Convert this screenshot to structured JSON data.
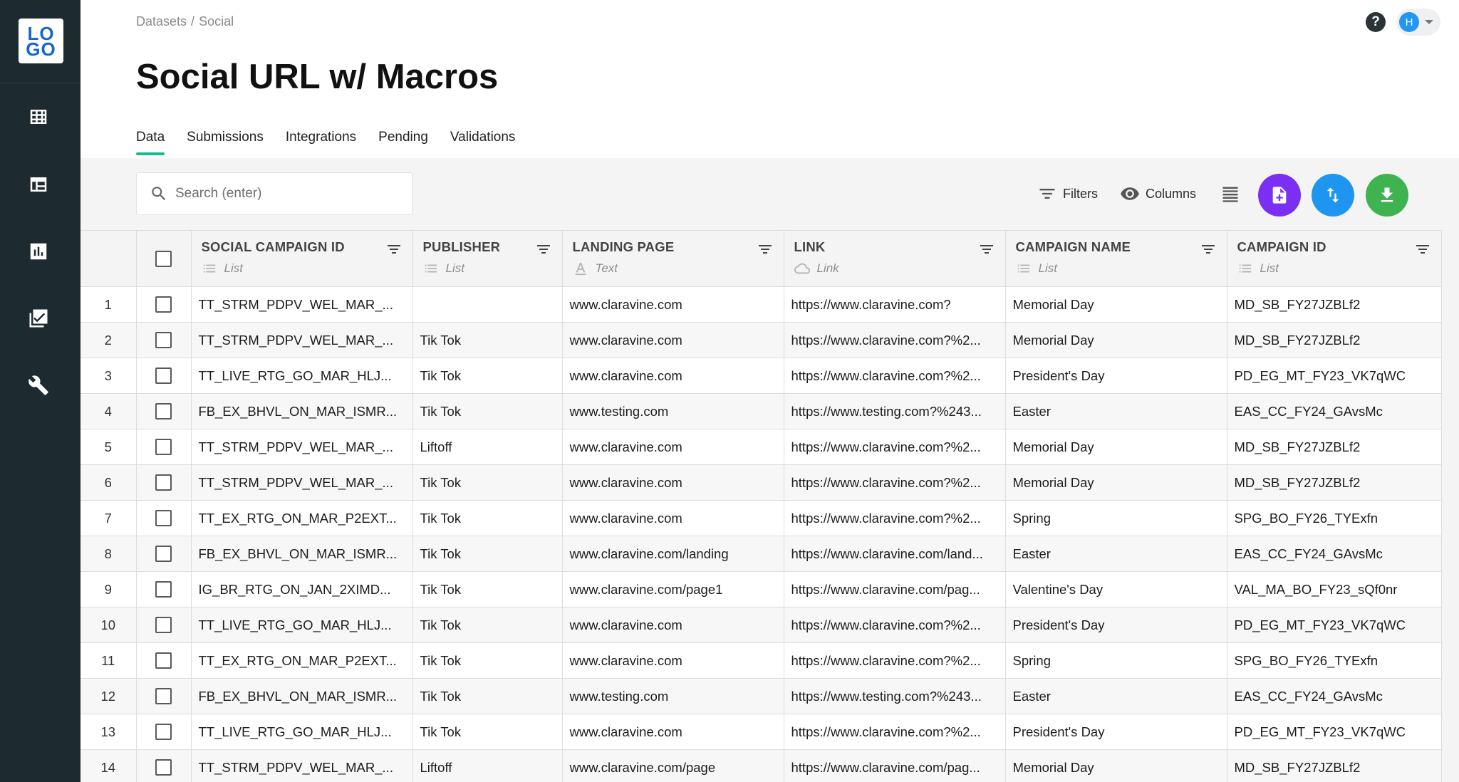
{
  "sidebar": {
    "logo_top": "LO",
    "logo_bottom": "GO",
    "items": [
      {
        "icon": "table-grid-icon"
      },
      {
        "icon": "layout-icon"
      },
      {
        "icon": "bar-chart-icon"
      },
      {
        "icon": "checklist-icon"
      },
      {
        "icon": "wrench-icon"
      }
    ]
  },
  "header": {
    "breadcrumb": [
      "Datasets",
      "Social"
    ],
    "breadcrumb_sep": "/",
    "help": "?",
    "user_initial": "H",
    "title": "Social URL w/ Macros"
  },
  "tabs": [
    "Data",
    "Submissions",
    "Integrations",
    "Pending",
    "Validations"
  ],
  "active_tab": "Data",
  "toolbar": {
    "search_placeholder": "Search (enter)",
    "filters_label": "Filters",
    "columns_label": "Columns"
  },
  "colors": {
    "sidebar": "#1d2b30",
    "accent_tab": "#18b98e",
    "add_button": "#7b2ff2",
    "sync_button": "#1e96f0",
    "download_button": "#3eb34f"
  },
  "table": {
    "columns": [
      {
        "title": "SOCIAL CAMPAIGN ID",
        "type": "List",
        "type_icon": "list-icon"
      },
      {
        "title": "PUBLISHER",
        "type": "List",
        "type_icon": "list-icon"
      },
      {
        "title": "LANDING PAGE",
        "type": "Text",
        "type_icon": "text-icon"
      },
      {
        "title": "LINK",
        "type": "Link",
        "type_icon": "link-cloud-icon"
      },
      {
        "title": "CAMPAIGN NAME",
        "type": "List",
        "type_icon": "list-icon"
      },
      {
        "title": "CAMPAIGN ID",
        "type": "List",
        "type_icon": "list-icon"
      }
    ],
    "rows": [
      [
        "1",
        "TT_STRM_PDPV_WEL_MAR_...",
        "",
        "www.claravine.com",
        "https://www.claravine.com?",
        "Memorial Day",
        "MD_SB_FY27JZBLf2"
      ],
      [
        "2",
        "TT_STRM_PDPV_WEL_MAR_...",
        "Tik Tok",
        "www.claravine.com",
        "https://www.claravine.com?%2...",
        "Memorial Day",
        "MD_SB_FY27JZBLf2"
      ],
      [
        "3",
        "TT_LIVE_RTG_GO_MAR_HLJ...",
        "Tik Tok",
        "www.claravine.com",
        "https://www.claravine.com?%2...",
        "President's Day",
        "PD_EG_MT_FY23_VK7qWC"
      ],
      [
        "4",
        "FB_EX_BHVL_ON_MAR_ISMR...",
        "Tik Tok",
        "www.testing.com",
        "https://www.testing.com?%243...",
        "Easter",
        "EAS_CC_FY24_GAvsMc"
      ],
      [
        "5",
        "TT_STRM_PDPV_WEL_MAR_...",
        "Liftoff",
        "www.claravine.com",
        "https://www.claravine.com?%2...",
        "Memorial Day",
        "MD_SB_FY27JZBLf2"
      ],
      [
        "6",
        "TT_STRM_PDPV_WEL_MAR_...",
        "Tik Tok",
        "www.claravine.com",
        "https://www.claravine.com?%2...",
        "Memorial Day",
        "MD_SB_FY27JZBLf2"
      ],
      [
        "7",
        "TT_EX_RTG_ON_MAR_P2EXT...",
        "Tik Tok",
        "www.claravine.com",
        "https://www.claravine.com?%2...",
        "Spring",
        "SPG_BO_FY26_TYExfn"
      ],
      [
        "8",
        "FB_EX_BHVL_ON_MAR_ISMR...",
        "Tik Tok",
        "www.claravine.com/landing",
        "https://www.claravine.com/land...",
        "Easter",
        "EAS_CC_FY24_GAvsMc"
      ],
      [
        "9",
        "IG_BR_RTG_ON_JAN_2XIMD...",
        "Tik Tok",
        "www.claravine.com/page1",
        "https://www.claravine.com/pag...",
        "Valentine's Day",
        "VAL_MA_BO_FY23_sQf0nr"
      ],
      [
        "10",
        "TT_LIVE_RTG_GO_MAR_HLJ...",
        "Tik Tok",
        "www.claravine.com",
        "https://www.claravine.com?%2...",
        "President's Day",
        "PD_EG_MT_FY23_VK7qWC"
      ],
      [
        "11",
        "TT_EX_RTG_ON_MAR_P2EXT...",
        "Tik Tok",
        "www.claravine.com",
        "https://www.claravine.com?%2...",
        "Spring",
        "SPG_BO_FY26_TYExfn"
      ],
      [
        "12",
        "FB_EX_BHVL_ON_MAR_ISMR...",
        "Tik Tok",
        "www.testing.com",
        "https://www.testing.com?%243...",
        "Easter",
        "EAS_CC_FY24_GAvsMc"
      ],
      [
        "13",
        "TT_LIVE_RTG_GO_MAR_HLJ...",
        "Tik Tok",
        "www.claravine.com",
        "https://www.claravine.com?%2...",
        "President's Day",
        "PD_EG_MT_FY23_VK7qWC"
      ],
      [
        "14",
        "TT_STRM_PDPV_WEL_MAR_...",
        "Liftoff",
        "www.claravine.com/page",
        "https://www.claravine.com/pag...",
        "Memorial Day",
        "MD_SB_FY27JZBLf2"
      ]
    ]
  }
}
